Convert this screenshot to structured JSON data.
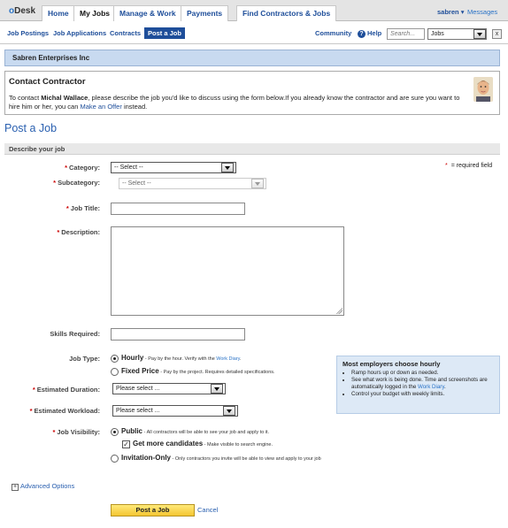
{
  "logo": {
    "o": "o",
    "rest": "Desk"
  },
  "nav": {
    "home": "Home",
    "my_jobs": "My Jobs",
    "manage": "Manage & Work",
    "payments": "Payments",
    "find": "Find Contractors & Jobs",
    "user": "sabren",
    "user_caret": "▾",
    "messages": "Messages"
  },
  "subnav": {
    "postings": "Job Postings",
    "applications": "Job Applications",
    "contracts": "Contracts",
    "post": "Post a Job",
    "community": "Community",
    "help": "Help",
    "search_placeholder": "Search...",
    "scope": "Jobs",
    "close": "x"
  },
  "company": "Sabren Enterprises Inc",
  "contact": {
    "title": "Contact Contractor",
    "pre": "To contact ",
    "name": "Michal Wallace",
    "mid": ", please describe the job you'd like to discuss using the form below.If you already know the contractor and are sure you want to hire him or her, you can ",
    "link": "Make an Offer",
    "post": " instead."
  },
  "page_title": "Post a Job",
  "section": "Describe your job",
  "required_mark": "*",
  "required_note": "= required field",
  "form": {
    "category_label": "Category:",
    "category_value": "-- Select --",
    "subcategory_label": "Subcategory:",
    "subcategory_value": "-- Select --",
    "title_label": "Job Title:",
    "description_label": "Description:",
    "skills_label": "Skills Required:",
    "jobtype_label": "Job Type:",
    "hourly": "Hourly",
    "hourly_desc": " - Pay by the hour. Verify with the ",
    "hourly_link": "Work Diary",
    "hourly_end": ".",
    "fixed": "Fixed Price",
    "fixed_desc": " - Pay by the project. Requires detailed specifications.",
    "duration_label": "Estimated Duration:",
    "duration_value": "Please select ...",
    "workload_label": "Estimated Workload:",
    "workload_value": "Please select ...",
    "visibility_label": "Job Visibility:",
    "public": "Public",
    "public_desc": " - All contractors will be able to see your job and apply to it.",
    "more_candidates": "Get more candidates",
    "more_candidates_desc": " - Make visible to search engine.",
    "invite_only": "Invitation-Only",
    "invite_only_desc": " - Only contractors you invite will be able to view and apply to your job"
  },
  "tip": {
    "title": "Most employers choose hourly",
    "items": [
      "Ramp hours up or down as needed.",
      "See what work is being done. Time and screenshots are automatically logged in the ",
      "Control your budget with weekly limits."
    ],
    "work_diary": "Work Diary",
    "period": "."
  },
  "advanced": "Advanced Options",
  "advanced_icon": "+",
  "post_button": "Post a Job",
  "cancel": "Cancel",
  "checkmark": "✓"
}
